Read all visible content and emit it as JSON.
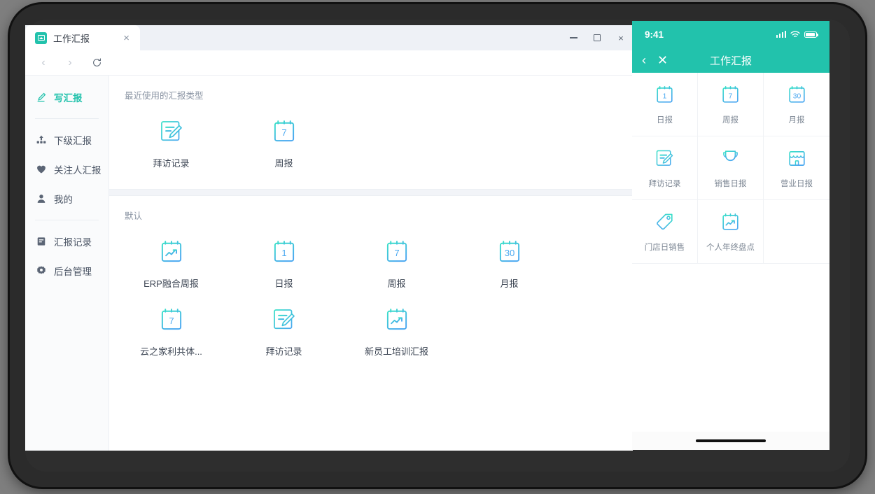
{
  "desktop": {
    "tab": {
      "title": "工作汇报",
      "close_label": "×",
      "favicon": "image-icon"
    },
    "nav": {
      "back": "‹",
      "forward": "›",
      "reload": "refresh-icon"
    },
    "window_controls": {
      "minimize": "minimize-icon",
      "maximize": "maximize-icon",
      "close": "×"
    },
    "sidebar": {
      "items": [
        {
          "label": "写汇报",
          "icon": "pen-icon",
          "active": true
        },
        {
          "label": "下级汇报",
          "icon": "hierarchy-icon",
          "active": false
        },
        {
          "label": "关注人汇报",
          "icon": "heart-icon",
          "active": false
        },
        {
          "label": "我的",
          "icon": "user-icon",
          "active": false
        },
        {
          "label": "汇报记录",
          "icon": "document-icon",
          "active": false
        },
        {
          "label": "后台管理",
          "icon": "gear-icon",
          "active": false
        }
      ]
    },
    "sections": [
      {
        "title": "最近使用的汇报类型",
        "items": [
          {
            "label": "拜访记录",
            "icon": "note-pen-icon"
          },
          {
            "label": "周报",
            "icon": "calendar-icon",
            "badge": "7"
          }
        ]
      },
      {
        "title": "默认",
        "items": [
          {
            "label": "ERP融合周报",
            "icon": "calendar-chart-icon"
          },
          {
            "label": "日报",
            "icon": "calendar-icon",
            "badge": "1"
          },
          {
            "label": "周报",
            "icon": "calendar-icon",
            "badge": "7"
          },
          {
            "label": "月报",
            "icon": "calendar-icon",
            "badge": "30"
          },
          {
            "label": "云之家利共体...",
            "icon": "calendar-icon",
            "badge": "7"
          },
          {
            "label": "拜访记录",
            "icon": "note-pen-icon"
          },
          {
            "label": "新员工培训汇报",
            "icon": "calendar-chart-icon"
          }
        ]
      }
    ]
  },
  "mobile": {
    "status": {
      "time": "9:41",
      "signal": "signal-bars-icon",
      "wifi": "wifi-icon",
      "battery": "battery-icon"
    },
    "nav": {
      "back": "‹",
      "close": "✕",
      "title": "工作汇报"
    },
    "grid": [
      {
        "label": "日报",
        "icon": "calendar-icon",
        "badge": "1"
      },
      {
        "label": "周报",
        "icon": "calendar-icon",
        "badge": "7"
      },
      {
        "label": "月报",
        "icon": "calendar-icon",
        "badge": "30"
      },
      {
        "label": "拜访记录",
        "icon": "note-pen-icon"
      },
      {
        "label": "销售日报",
        "icon": "trophy-icon"
      },
      {
        "label": "营业日报",
        "icon": "shop-icon"
      },
      {
        "label": "门店日销售",
        "icon": "tag-icon"
      },
      {
        "label": "个人年终盘点",
        "icon": "calendar-chart-icon"
      },
      {
        "label": "",
        "icon": ""
      }
    ],
    "home_indicator": "home-indicator"
  },
  "colors": {
    "brand_teal": "#22c2ac",
    "icon_gradient_from": "#3ae0c8",
    "icon_gradient_to": "#4aa8f0",
    "sidebar_bg": "#fafbfc",
    "tabstrip_bg": "#eef1f6",
    "bezel": "#2b2b2b"
  }
}
